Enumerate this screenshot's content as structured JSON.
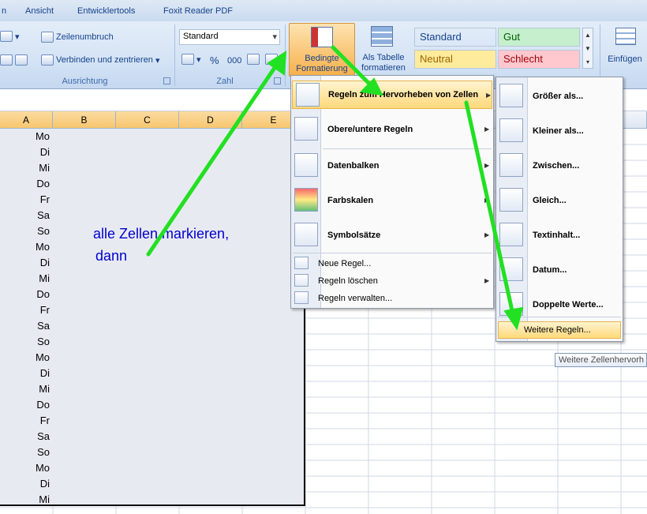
{
  "tabs": [
    "n",
    "Ansicht",
    "Entwicklertools",
    "Foxit Reader PDF"
  ],
  "ribbon": {
    "zeilenumbruch": "Zeilenumbruch",
    "verbinden": "Verbinden und zentrieren",
    "ausrichtung_label": "Ausrichtung",
    "number_format": "Standard",
    "percent": "%",
    "thousands": "000",
    "zahl_label": "Zahl",
    "bedingte_line1": "Bedingte",
    "bedingte_line2": "Formatierung",
    "tabelle_line1": "Als Tabelle",
    "tabelle_line2": "formatieren",
    "styles": [
      {
        "label": "Standard",
        "bg": "#ffffff",
        "color": "#000000"
      },
      {
        "label": "Gut",
        "bg": "#c6efce",
        "color": "#006100"
      },
      {
        "label": "Neutral",
        "bg": "#ffeb9c",
        "color": "#9c6500"
      },
      {
        "label": "Schlecht",
        "bg": "#ffc7ce",
        "color": "#9c0006"
      }
    ],
    "einfuegen": "Einfügen"
  },
  "columns": [
    "A",
    "B",
    "C",
    "D",
    "E"
  ],
  "cells": [
    "Mo",
    "Di",
    "Mi",
    "Do",
    "Fr",
    "Sa",
    "So",
    "Mo",
    "Di",
    "Mi",
    "Do",
    "Fr",
    "Sa",
    "So",
    "Mo",
    "Di",
    "Mi",
    "Do",
    "Fr",
    "Sa",
    "So",
    "Mo",
    "Di",
    "Mi"
  ],
  "annotation": {
    "line1": "alle Zellen markieren,",
    "line2": "dann"
  },
  "menu": {
    "items": [
      {
        "label": "Regeln zum Hervorheben von Zellen",
        "icon": "highlight-rules-icon"
      },
      {
        "label": "Obere/untere Regeln",
        "icon": "top-bottom-icon"
      },
      {
        "label": "Datenbalken",
        "icon": "databar-icon"
      },
      {
        "label": "Farbskalen",
        "icon": "colorscale-icon"
      },
      {
        "label": "Symbolsätze",
        "icon": "iconset-icon"
      }
    ],
    "small_items": [
      {
        "label": "Neue Regel...",
        "icon": "new-rule-icon"
      },
      {
        "label": "Regeln löschen",
        "icon": "delete-rules-icon"
      },
      {
        "label": "Regeln verwalten...",
        "icon": "manage-rules-icon"
      }
    ]
  },
  "submenu": {
    "items": [
      {
        "label": "Größer als...",
        "icon": "greater-than-icon"
      },
      {
        "label": "Kleiner als...",
        "icon": "less-than-icon"
      },
      {
        "label": "Zwischen...",
        "icon": "between-icon"
      },
      {
        "label": "Gleich...",
        "icon": "equal-icon"
      },
      {
        "label": "Textinhalt...",
        "icon": "text-contains-icon"
      },
      {
        "label": "Datum...",
        "icon": "date-icon"
      },
      {
        "label": "Doppelte Werte...",
        "icon": "duplicate-values-icon"
      }
    ],
    "more": "Weitere Regeln..."
  },
  "tooltip": "Weitere Zellenhervorh"
}
